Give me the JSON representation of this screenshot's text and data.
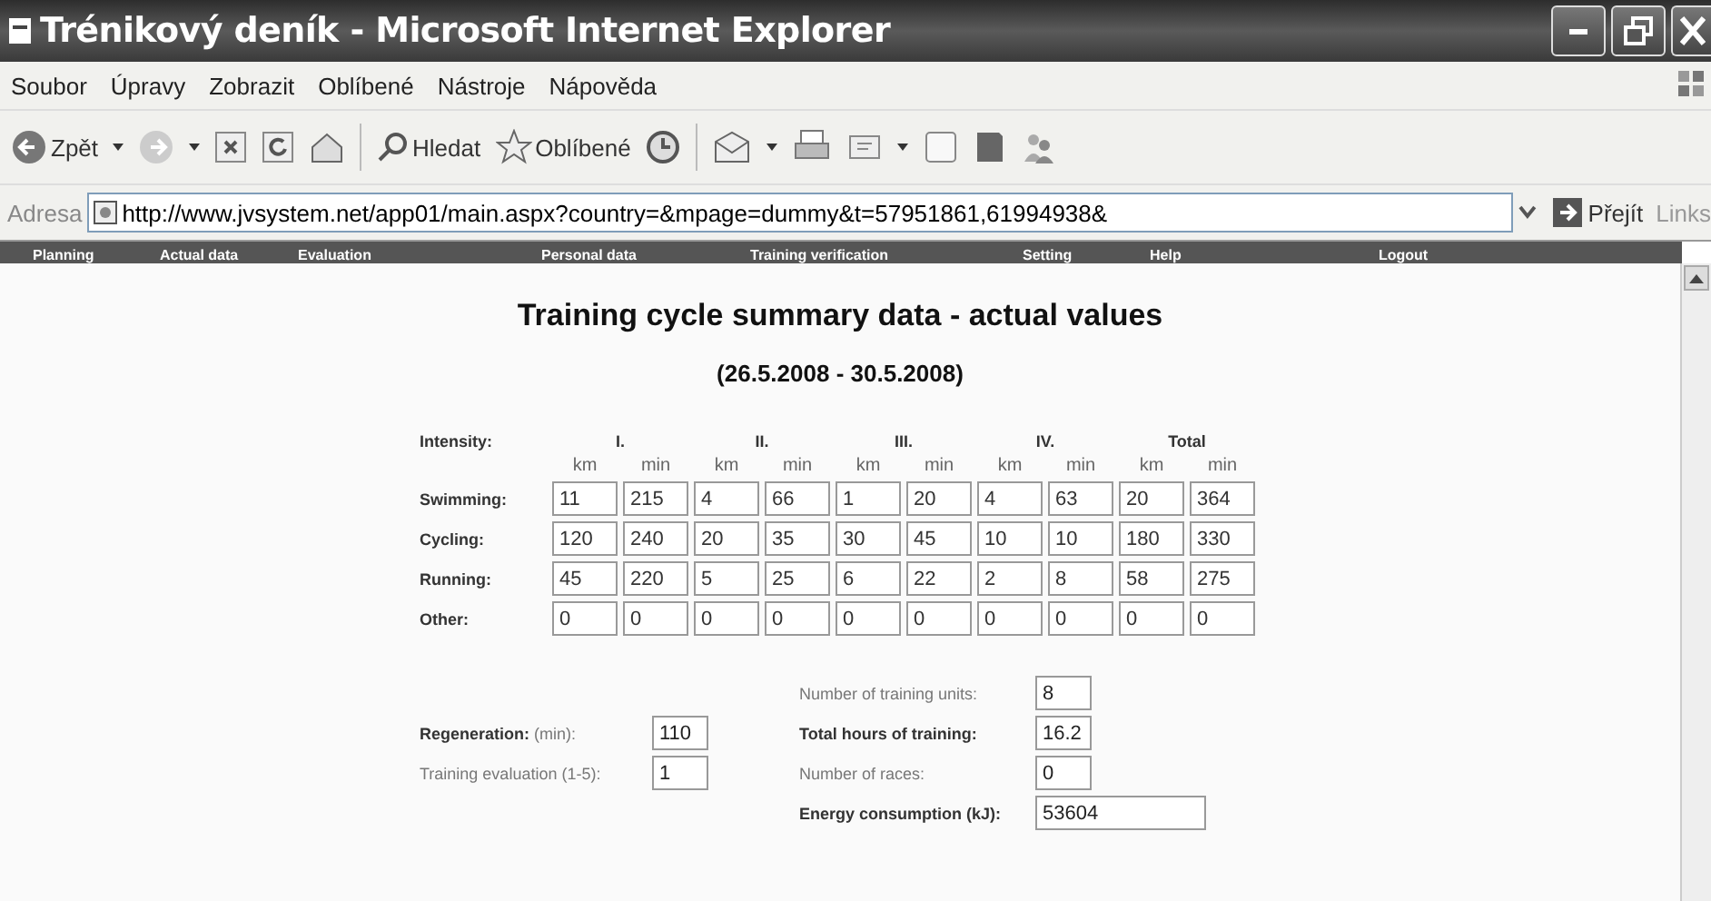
{
  "window": {
    "title": "Trénikový deník - Microsoft Internet Explorer"
  },
  "menu": [
    "Soubor",
    "Úpravy",
    "Zobrazit",
    "Oblíbené",
    "Nástroje",
    "Nápověda"
  ],
  "toolbar": {
    "back": "Zpět",
    "search": "Hledat",
    "favorites": "Oblíbené"
  },
  "address": {
    "label": "Adresa",
    "url": "http://www.jvsystem.net/app01/main.aspx?country=&mpage=dummy&t=57951861,61994938&",
    "go": "Přejít",
    "links": "Links"
  },
  "nav": [
    "Planning",
    "Actual data",
    "Evaluation",
    "Personal data",
    "Training verification",
    "Setting",
    "Help",
    "Logout"
  ],
  "heading": "Training cycle summary data - actual values",
  "period": "(26.5.2008 - 30.5.2008)",
  "table": {
    "label": "Intensity:",
    "groups": [
      {
        "name": "I.",
        "units": [
          "km",
          "min"
        ]
      },
      {
        "name": "II.",
        "units": [
          "km",
          "min"
        ]
      },
      {
        "name": "III.",
        "units": [
          "km",
          "min"
        ]
      },
      {
        "name": "IV.",
        "units": [
          "km",
          "min"
        ]
      },
      {
        "name": "Total",
        "units": [
          "km",
          "min"
        ]
      }
    ],
    "rows": [
      {
        "name": "Swimming:",
        "values": [
          "11",
          "215",
          "4",
          "66",
          "1",
          "20",
          "4",
          "63",
          "20",
          "364"
        ]
      },
      {
        "name": "Cycling:",
        "values": [
          "120",
          "240",
          "20",
          "35",
          "30",
          "45",
          "10",
          "10",
          "180",
          "330"
        ]
      },
      {
        "name": "Running:",
        "values": [
          "45",
          "220",
          "5",
          "25",
          "6",
          "22",
          "2",
          "8",
          "58",
          "275"
        ]
      },
      {
        "name": "Other:",
        "values": [
          "0",
          "0",
          "0",
          "0",
          "0",
          "0",
          "0",
          "0",
          "0",
          "0"
        ]
      }
    ]
  },
  "left_fields": [
    {
      "label": "**Regeneration:** (min):",
      "value": "110"
    },
    {
      "label": "Training evaluation (1-5):",
      "value": "1"
    }
  ],
  "right_fields": [
    {
      "label": "Number of training units:",
      "value": "8",
      "bold": false,
      "wide": false
    },
    {
      "label": "Total hours of training:",
      "value": "16.2",
      "bold": true,
      "wide": false
    },
    {
      "label": "Number of races:",
      "value": "0",
      "bold": false,
      "wide": false
    },
    {
      "label": "Energy consumption (kJ):",
      "value": "53604",
      "bold": true,
      "wide": true
    }
  ]
}
